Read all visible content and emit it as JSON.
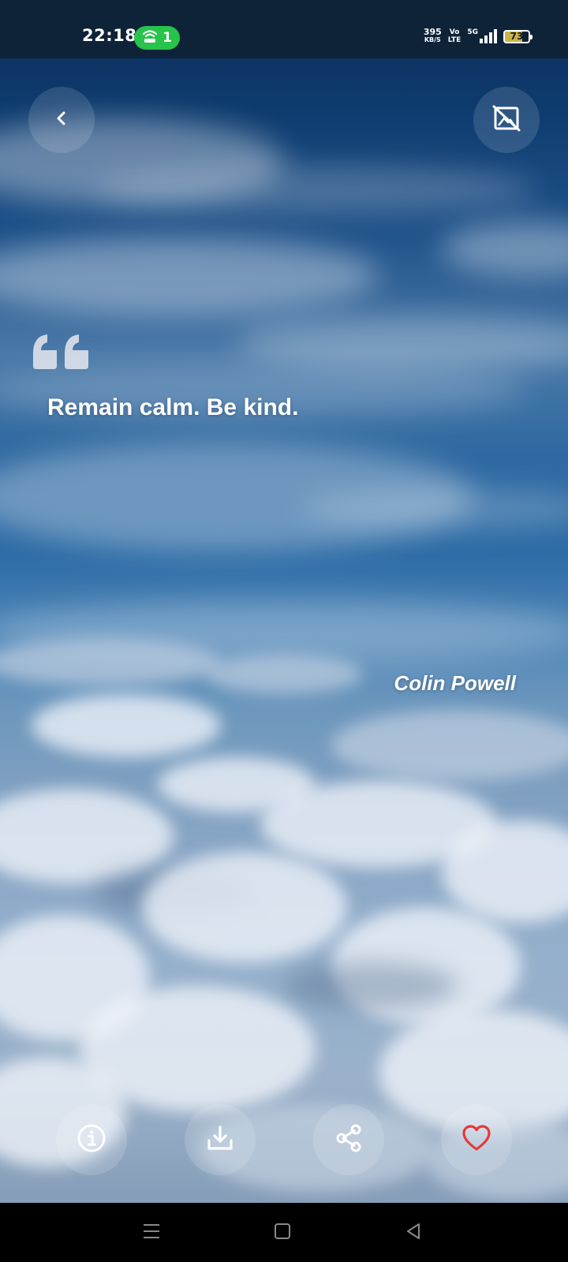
{
  "status_bar": {
    "time": "22:18",
    "hotspot_count": "1",
    "net_speed_value": "395",
    "net_speed_unit": "KB/S",
    "volte_top": "Vo",
    "volte_bottom": "LTE",
    "network_type": "5G",
    "battery_level": "73"
  },
  "quote": {
    "text": "Remain calm. Be kind.",
    "author": "Colin Powell"
  },
  "icons": {
    "back": "chevron-left-icon",
    "hide_image": "image-off-icon",
    "info": "info-icon",
    "download": "download-icon",
    "share": "share-icon",
    "favorite": "heart-icon"
  },
  "colors": {
    "hotspot_pill": "#27c34a",
    "favorite": "#e53935"
  }
}
